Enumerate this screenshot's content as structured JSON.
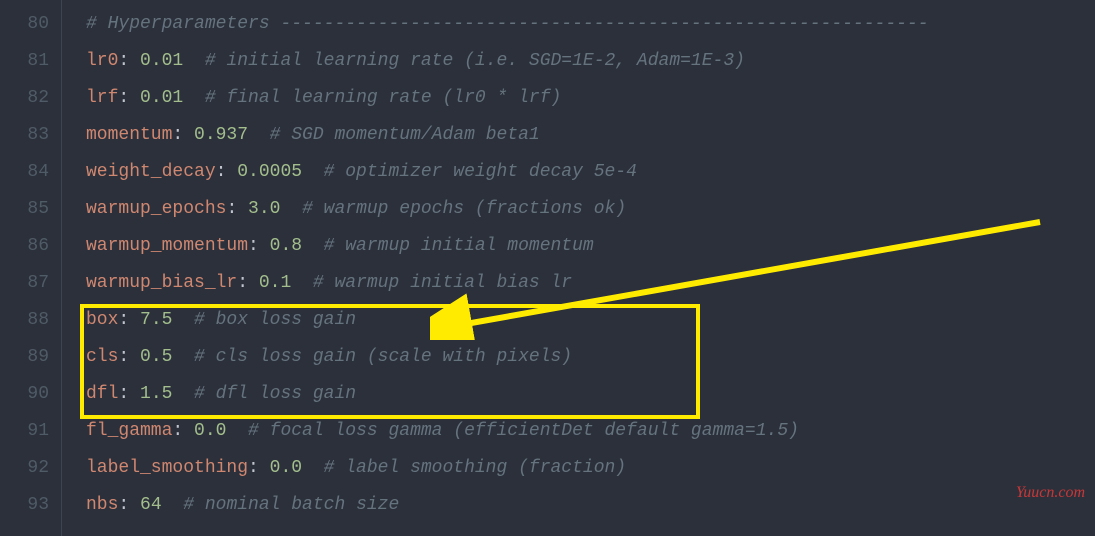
{
  "watermark": "Yuucn.com",
  "lines": [
    {
      "num": "80",
      "key": "",
      "value": "",
      "comment": "# Hyperparameters ------------------------------------------------------------"
    },
    {
      "num": "81",
      "key": "lr0",
      "value": "0.01",
      "comment": "# initial learning rate (i.e. SGD=1E-2, Adam=1E-3)"
    },
    {
      "num": "82",
      "key": "lrf",
      "value": "0.01",
      "comment": "# final learning rate (lr0 * lrf)"
    },
    {
      "num": "83",
      "key": "momentum",
      "value": "0.937",
      "comment": "# SGD momentum/Adam beta1"
    },
    {
      "num": "84",
      "key": "weight_decay",
      "value": "0.0005",
      "comment": "# optimizer weight decay 5e-4"
    },
    {
      "num": "85",
      "key": "warmup_epochs",
      "value": "3.0",
      "comment": "# warmup epochs (fractions ok)"
    },
    {
      "num": "86",
      "key": "warmup_momentum",
      "value": "0.8",
      "comment": "# warmup initial momentum"
    },
    {
      "num": "87",
      "key": "warmup_bias_lr",
      "value": "0.1",
      "comment": "# warmup initial bias lr"
    },
    {
      "num": "88",
      "key": "box",
      "value": "7.5",
      "comment": "# box loss gain"
    },
    {
      "num": "89",
      "key": "cls",
      "value": "0.5",
      "comment": "# cls loss gain (scale with pixels)"
    },
    {
      "num": "90",
      "key": "dfl",
      "value": "1.5",
      "comment": "# dfl loss gain"
    },
    {
      "num": "91",
      "key": "fl_gamma",
      "value": "0.0",
      "comment": "# focal loss gamma (efficientDet default gamma=1.5)"
    },
    {
      "num": "92",
      "key": "label_smoothing",
      "value": "0.0",
      "comment": "# label smoothing (fraction)"
    },
    {
      "num": "93",
      "key": "nbs",
      "value": "64",
      "comment": "# nominal batch size"
    }
  ]
}
